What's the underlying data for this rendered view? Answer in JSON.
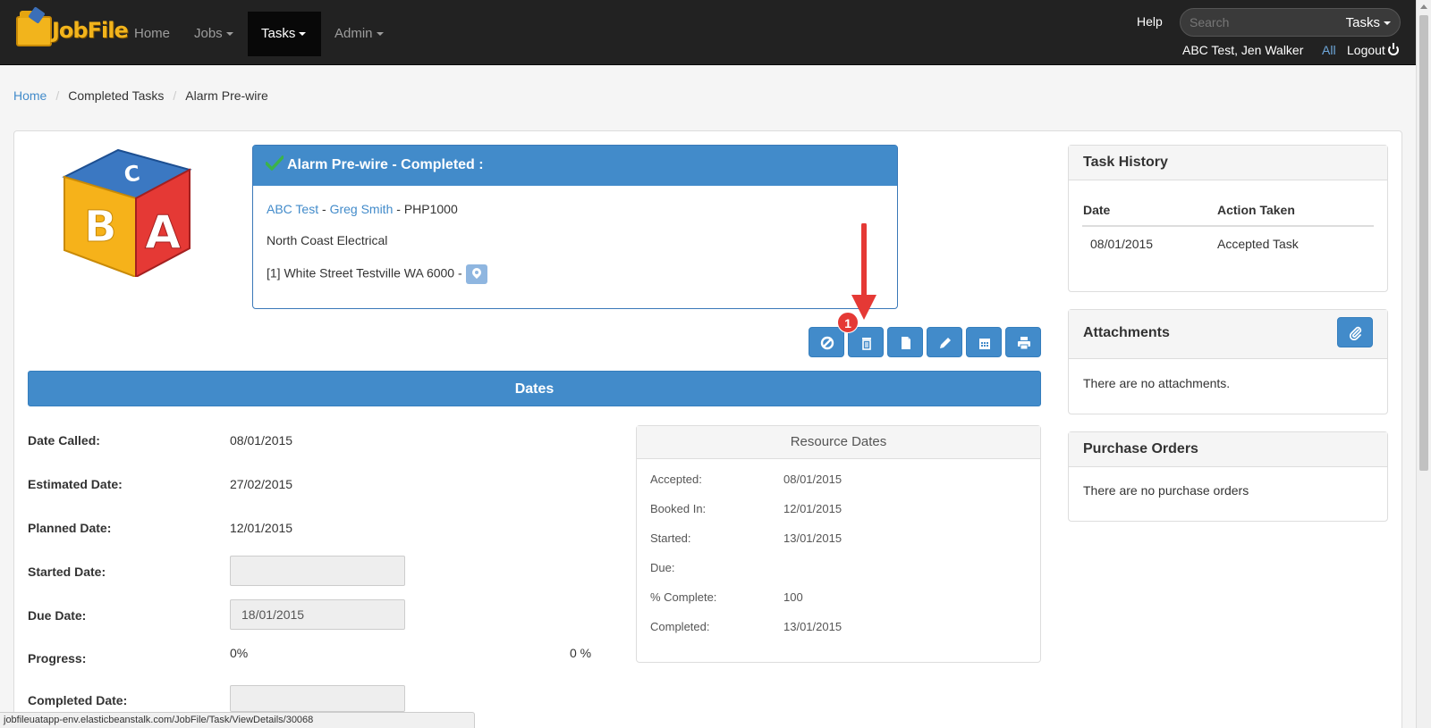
{
  "navbar": {
    "brand": "JobFile",
    "items": [
      {
        "label": "Home",
        "dropdown": false
      },
      {
        "label": "Jobs",
        "dropdown": true
      },
      {
        "label": "Tasks",
        "dropdown": true,
        "active": true
      },
      {
        "label": "Admin",
        "dropdown": true
      }
    ],
    "help": "Help",
    "search_placeholder": "Search",
    "search_scope": "Tasks",
    "user": "ABC Test, Jen Walker",
    "all": "All",
    "logout": "Logout"
  },
  "breadcrumb": [
    "Home",
    "Completed Tasks",
    "Alarm Pre-wire"
  ],
  "task": {
    "title": "Alarm Pre-wire - Completed :",
    "client": "ABC Test",
    "contact": "Greg Smith",
    "job_code": "PHP1000",
    "company": "North Coast Electrical",
    "address": "[1] White Street Testville WA 6000 -"
  },
  "annotation": {
    "badge": "1"
  },
  "dates": {
    "title": "Dates",
    "fields": [
      {
        "label": "Date Called:",
        "value": "08/01/2015",
        "type": "text"
      },
      {
        "label": "Estimated Date:",
        "value": "27/02/2015",
        "type": "text"
      },
      {
        "label": "Planned Date:",
        "value": "12/01/2015",
        "type": "text"
      },
      {
        "label": "Started Date:",
        "value": "",
        "type": "input"
      },
      {
        "label": "Due Date:",
        "value": "18/01/2015",
        "type": "input"
      },
      {
        "label": "Progress:",
        "value": "0%",
        "value_right": "0 %",
        "type": "progress"
      },
      {
        "label": "Completed Date:",
        "value": "",
        "type": "input"
      }
    ]
  },
  "resource_dates": {
    "title": "Resource Dates",
    "rows": [
      {
        "label": "Accepted:",
        "value": "08/01/2015"
      },
      {
        "label": "Booked In:",
        "value": "12/01/2015"
      },
      {
        "label": "Started:",
        "value": "13/01/2015"
      },
      {
        "label": "Due:",
        "value": ""
      },
      {
        "label": "% Complete:",
        "value": "100"
      },
      {
        "label": "Completed:",
        "value": "13/01/2015"
      }
    ]
  },
  "task_history": {
    "title": "Task History",
    "columns": [
      "Date",
      "Action Taken"
    ],
    "rows": [
      [
        "08/01/2015",
        "Accepted Task"
      ]
    ]
  },
  "attachments": {
    "title": "Attachments",
    "empty": "There are no attachments."
  },
  "purchase_orders": {
    "title": "Purchase Orders",
    "empty": "There are no purchase orders"
  },
  "status_bar": "jobfileuatapp-env.elasticbeanstalk.com/JobFile/Task/ViewDetails/30068",
  "colors": {
    "primary": "#428bca",
    "navbar": "#222222",
    "badge": "#e53935"
  }
}
